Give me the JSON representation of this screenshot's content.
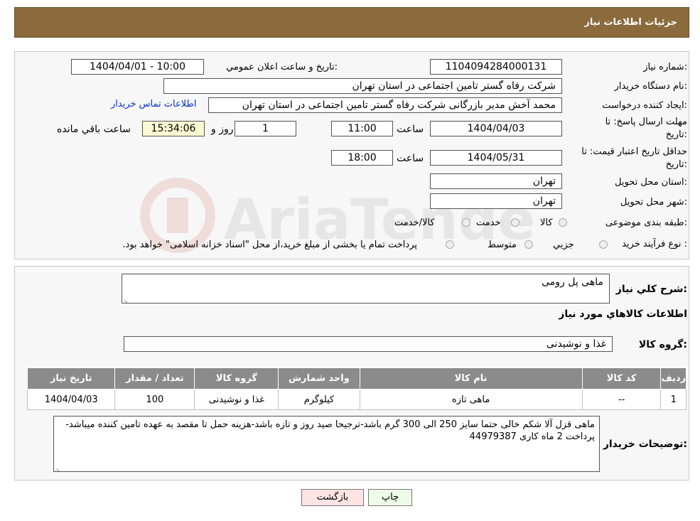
{
  "header": {
    "title": "جزئیات اطلاعات نیاز"
  },
  "info": {
    "need_number_label": "شماره نیاز:",
    "need_number": "1104094284000131",
    "announce_label": "تاریخ و ساعت اعلان عمومي:",
    "announce_value": "1404/04/01 - 10:00",
    "buyer_org_label": "نام دستگاه خریدار:",
    "buyer_org": "شرکت رفاه گستر تامین اجتماعی در استان تهران",
    "requester_label": "ایجاد کننده درخواست:",
    "requester": "محمد آخش مدیر بازرگانی شرکت رفاه گستر تامین اجتماعی در استان تهران",
    "contact_link": "اطلاعات تماس خریدار",
    "deadline_label_1": "مهلت ارسال پاسخ: تا",
    "deadline_label_2": "تاریخ:",
    "deadline_date": "1404/04/03",
    "time_label": "ساعت",
    "deadline_time": "11:00",
    "days_value": "1",
    "days_label": "روز و",
    "remaining_time": "15:34:06",
    "remaining_label": "ساعت باقي مانده",
    "validity_label_1": "حداقل تاریخ اعتبار قیمت: تا",
    "validity_label_2": "تاریخ:",
    "validity_date": "1404/05/31",
    "validity_time": "18:00",
    "province_label": "استان محل تحویل:",
    "province": "تهران",
    "city_label": "شهر محل تحویل:",
    "city": "تهران",
    "category_label": "طبقه بندی موضوعی:",
    "category_options": [
      "کالا",
      "خدمت",
      "کالا/خدمت"
    ],
    "process_label": "نوع فرآیند خرید :",
    "process_options": [
      "جزيي",
      "متوسط"
    ],
    "process_note": "پرداخت تمام یا بخشی از مبلغ خرید،از محل \"اسناد خزانه اسلامی\" خواهد بود."
  },
  "details": {
    "summary_label": "شرح كلي نياز:",
    "summary": "ماهی پل رومی",
    "goods_heading": "اطلاعات كالاهاي مورد نياز",
    "group_label": "گروه كالا:",
    "group": "غذا و نوشیدنی",
    "table": {
      "headers": [
        "رديف",
        "كد كالا",
        "نام كالا",
        "واحد شمارش",
        "گروه كالا",
        "تعداد / مقدار",
        "تاریخ نیاز"
      ],
      "rows": [
        [
          "1",
          "--",
          "ماهی تازه",
          "كيلوگرم",
          "غذا و نوشیدنی",
          "100",
          "1404/04/03"
        ]
      ]
    },
    "notes_label": "توضیحات خریدار:",
    "notes": "ماهی قزل آلا شکم خالی حتما سایز 250 الی 300 گرم باشد-ترجیحا صید روز و تازه باشد-هزینه حمل تا مقصد به عهده تامین کننده میباشد-پرداخت 2 ماه کاری 44979387"
  },
  "buttons": {
    "print": "چاپ",
    "back": "بازگشت"
  },
  "colors": {
    "header_bg": "#8b6a3c",
    "table_header_bg": "#8b8b8b",
    "link": "#0a2fd6",
    "print_btn_bg": "#eefbe8",
    "back_btn_bg": "#fde4e4"
  }
}
